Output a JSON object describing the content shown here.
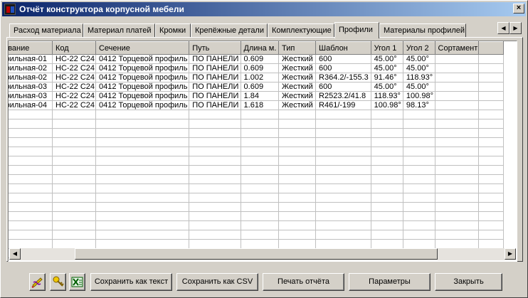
{
  "window": {
    "title": "Отчёт конструктора корпусной мебели",
    "close_glyph": "×"
  },
  "tabs": [
    {
      "label": "Расход материала"
    },
    {
      "label": "Материал платей"
    },
    {
      "label": "Кромки"
    },
    {
      "label": "Крепёжные детали"
    },
    {
      "label": "Комплектующие"
    },
    {
      "label": "Профили"
    },
    {
      "label": "Материалы профилей"
    }
  ],
  "active_tab": "Профили",
  "tab_scroll": {
    "left": "◀",
    "right": "▶"
  },
  "table": {
    "columns": [
      "нование",
      "Код",
      "Сечение",
      "Путь",
      "Длина м.",
      "Тип",
      "Шаблон",
      "Угол 1",
      "Угол 2",
      "Сортамент"
    ],
    "rows": [
      [
        "офильная-01",
        "НС-22 С24",
        "0412 Торцевой профиль",
        "ПО ПАНЕЛИ",
        "0.609",
        "Жесткий",
        "600",
        "45.00°",
        "45.00°",
        ""
      ],
      [
        "офильная-02",
        "НС-22 С24",
        "0412 Торцевой профиль",
        "ПО ПАНЕЛИ",
        "0.609",
        "Жесткий",
        "600",
        "45.00°",
        "45.00°",
        ""
      ],
      [
        "офильная-02",
        "НС-22 С24",
        "0412 Торцевой профиль",
        "ПО ПАНЕЛИ",
        "1.002",
        "Жесткий",
        "R364.2/-155.3",
        "91.46°",
        "118.93°",
        ""
      ],
      [
        "офильная-03",
        "НС-22 С24",
        "0412 Торцевой профиль",
        "ПО ПАНЕЛИ",
        "0.609",
        "Жесткий",
        "600",
        "45.00°",
        "45.00°",
        ""
      ],
      [
        "офильная-03",
        "НС-22 С24",
        "0412 Торцевой профиль",
        "ПО ПАНЕЛИ",
        "1.84",
        "Жесткий",
        "R2523.2/41.8",
        "118.93°",
        "100.98°",
        ""
      ],
      [
        "офильная-04",
        "НС-22 С24",
        "0412 Торцевой профиль",
        "ПО ПАНЕЛИ",
        "1.618",
        "Жесткий",
        "R461/-199",
        "100.98°",
        "98.13°",
        ""
      ]
    ]
  },
  "scrollbar": {
    "left": "◀",
    "right": "▶"
  },
  "toolbar": {
    "icons": [
      "edit-icon",
      "key-icon",
      "excel-icon"
    ],
    "buttons": [
      "Сохранить как текст",
      "Сохранить как CSV",
      "Печать отчёта",
      "Параметры",
      "Закрыть"
    ]
  }
}
